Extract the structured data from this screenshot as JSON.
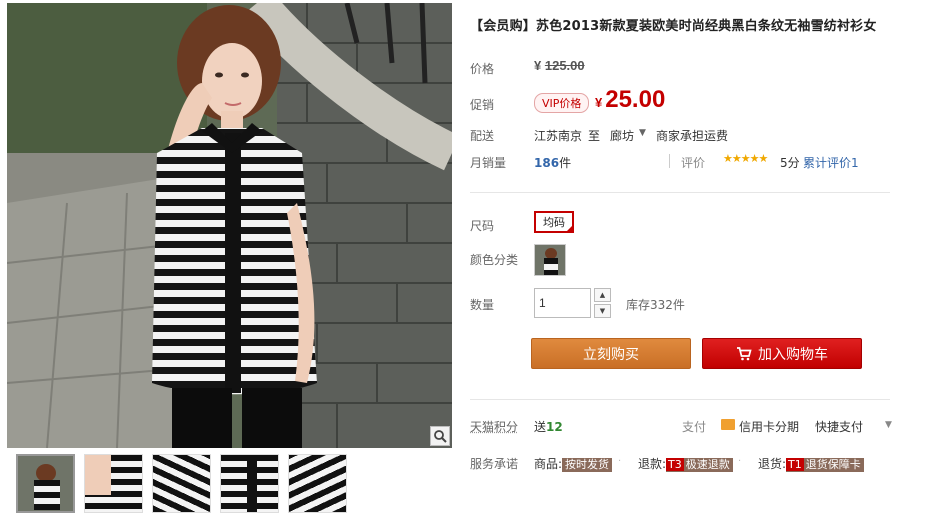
{
  "product": {
    "title": "【会员购】苏色2013新款夏装欧美时尚经典黑白条纹无袖雪纺衬衫女"
  },
  "price": {
    "label": "价格",
    "currency": "¥",
    "original": "125.00"
  },
  "promo": {
    "label": "促销",
    "badge": "VIP价格",
    "currency": "¥",
    "value": "25.00"
  },
  "shipping": {
    "label": "配送",
    "from": "江苏南京",
    "to_prefix": "至",
    "to": "廊坊",
    "fee": "商家承担运费"
  },
  "sales": {
    "label": "月销量",
    "count": "186",
    "unit": "件"
  },
  "rating": {
    "label": "评价",
    "stars": "★★★★★",
    "score": "5分",
    "reviews": "累计评价1"
  },
  "size": {
    "label": "尺码",
    "option": "均码"
  },
  "color": {
    "label": "颜色分类"
  },
  "quantity": {
    "label": "数量",
    "value": "1",
    "stock": "库存332件"
  },
  "actions": {
    "buy_now": "立刻购买",
    "add_to_cart": "加入购物车"
  },
  "points": {
    "label": "天猫积分",
    "prefix": "送",
    "value": "12"
  },
  "payment": {
    "label": "支付",
    "installment": "信用卡分期",
    "quickpay": "快捷支付"
  },
  "service": {
    "label": "服务承诺",
    "items": [
      {
        "prefix": "商品:",
        "tag": "按时发货",
        "badge": ""
      },
      {
        "prefix": "退款:",
        "tag": "极速退款",
        "badge": "T3"
      },
      {
        "prefix": "退货:",
        "tag": "退货保障卡",
        "badge": "T1"
      }
    ]
  },
  "colors": {
    "price_red": "#c40000",
    "buy_now_orange": "#d97a30",
    "cart_red": "#d00000",
    "link_blue": "#3366aa",
    "star_gold": "#f0a800"
  }
}
